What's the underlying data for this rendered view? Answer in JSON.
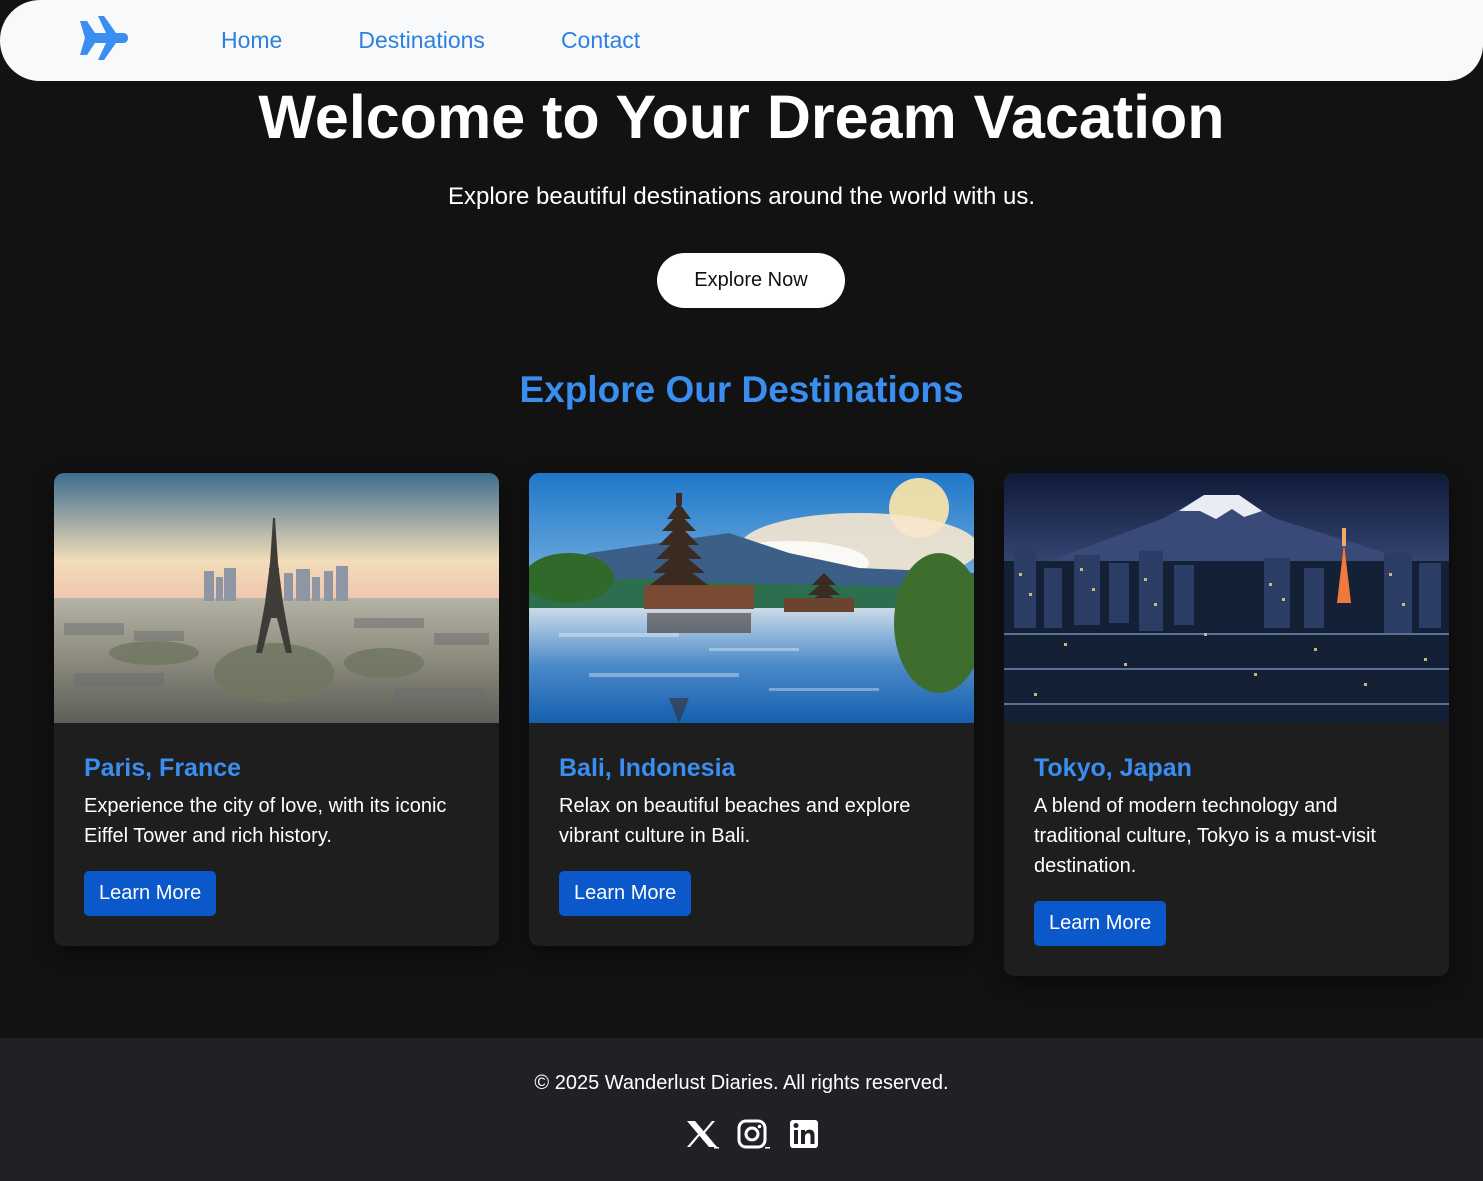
{
  "nav": {
    "brand_icon": "airplane-icon",
    "links": [
      "Home",
      "Destinations",
      "Contact"
    ],
    "link_color": "#2f7fde"
  },
  "hero": {
    "title": "Welcome to Your Dream Vacation",
    "subtitle": "Explore beautiful destinations around the world with us.",
    "button": "Explore Now"
  },
  "destinations": {
    "heading": "Explore Our Destinations",
    "accent": "#3a8ef0",
    "cards": [
      {
        "title": "Paris, France",
        "text": "Experience the city of love, with its iconic Eiffel Tower and rich history.",
        "button": "Learn More",
        "image": "paris-eiffel-tower-skyline"
      },
      {
        "title": "Bali, Indonesia",
        "text": "Relax on beautiful beaches and explore vibrant culture in Bali.",
        "button": "Learn More",
        "image": "bali-lake-temple"
      },
      {
        "title": "Tokyo, Japan",
        "text": "A blend of modern technology and traditional culture, Tokyo is a must-visit destination.",
        "button": "Learn More",
        "image": "tokyo-night-mount-fuji"
      }
    ]
  },
  "footer": {
    "copyright": "© 2025 Wanderlust Diaries. All rights reserved.",
    "socials": [
      "x-icon",
      "instagram-icon",
      "linkedin-icon"
    ]
  }
}
